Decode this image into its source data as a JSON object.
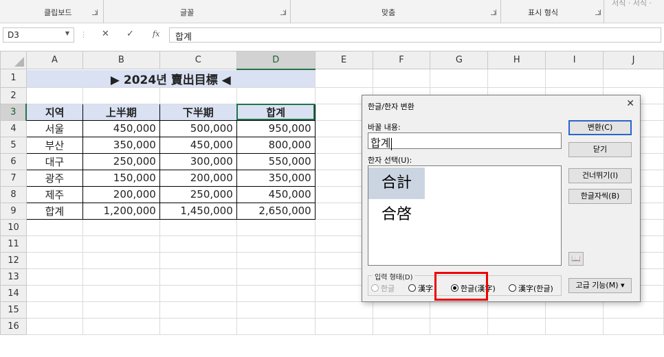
{
  "ribbon": {
    "groups": [
      "클립보드",
      "글꼴",
      "맞춤",
      "표시 형식"
    ],
    "clipped_text": "서식 · 서식 ·"
  },
  "formula_bar": {
    "name_box": "D3",
    "fx_label": "fx",
    "content": "합계"
  },
  "grid": {
    "columns": [
      "A",
      "B",
      "C",
      "D",
      "E",
      "F",
      "G",
      "H",
      "I",
      "J"
    ],
    "rows": [
      "1",
      "2",
      "3",
      "4",
      "5",
      "6",
      "7",
      "8",
      "9",
      "10",
      "11",
      "12",
      "13",
      "14",
      "15",
      "16"
    ],
    "selected_column": "D",
    "selected_row": "3",
    "title": "▶ 2024년 賣出目標 ◀",
    "table_headers": [
      "지역",
      "上半期",
      "下半期",
      "합계"
    ],
    "table_rows": [
      [
        "서울",
        "450,000",
        "500,000",
        "950,000"
      ],
      [
        "부산",
        "350,000",
        "450,000",
        "800,000"
      ],
      [
        "대구",
        "250,000",
        "300,000",
        "550,000"
      ],
      [
        "광주",
        "150,000",
        "200,000",
        "350,000"
      ],
      [
        "제주",
        "200,000",
        "250,000",
        "450,000"
      ],
      [
        "합계",
        "1,200,000",
        "1,450,000",
        "2,650,000"
      ]
    ]
  },
  "dialog": {
    "title": "한글/한자 변환",
    "change_label": "바꿀 내용:",
    "change_value": "합계",
    "hanja_label": "한자 선택(U):",
    "hanja_options": [
      "合計",
      "合啓"
    ],
    "selected_hanja": "合計",
    "buttons": {
      "convert": "변환(C)",
      "close": "닫기",
      "skip": "건너뛰기(I)",
      "dictionary": "한글자씩(B)",
      "advanced": "고급 기능(M) ▾"
    },
    "input_form_label": "입력 형태(D)",
    "input_forms": [
      "한글",
      "漢字",
      "한글(漢字)",
      "漢字(한글)"
    ],
    "selected_input_form": "한글(漢字)",
    "highlight_color": "#ee0000"
  }
}
